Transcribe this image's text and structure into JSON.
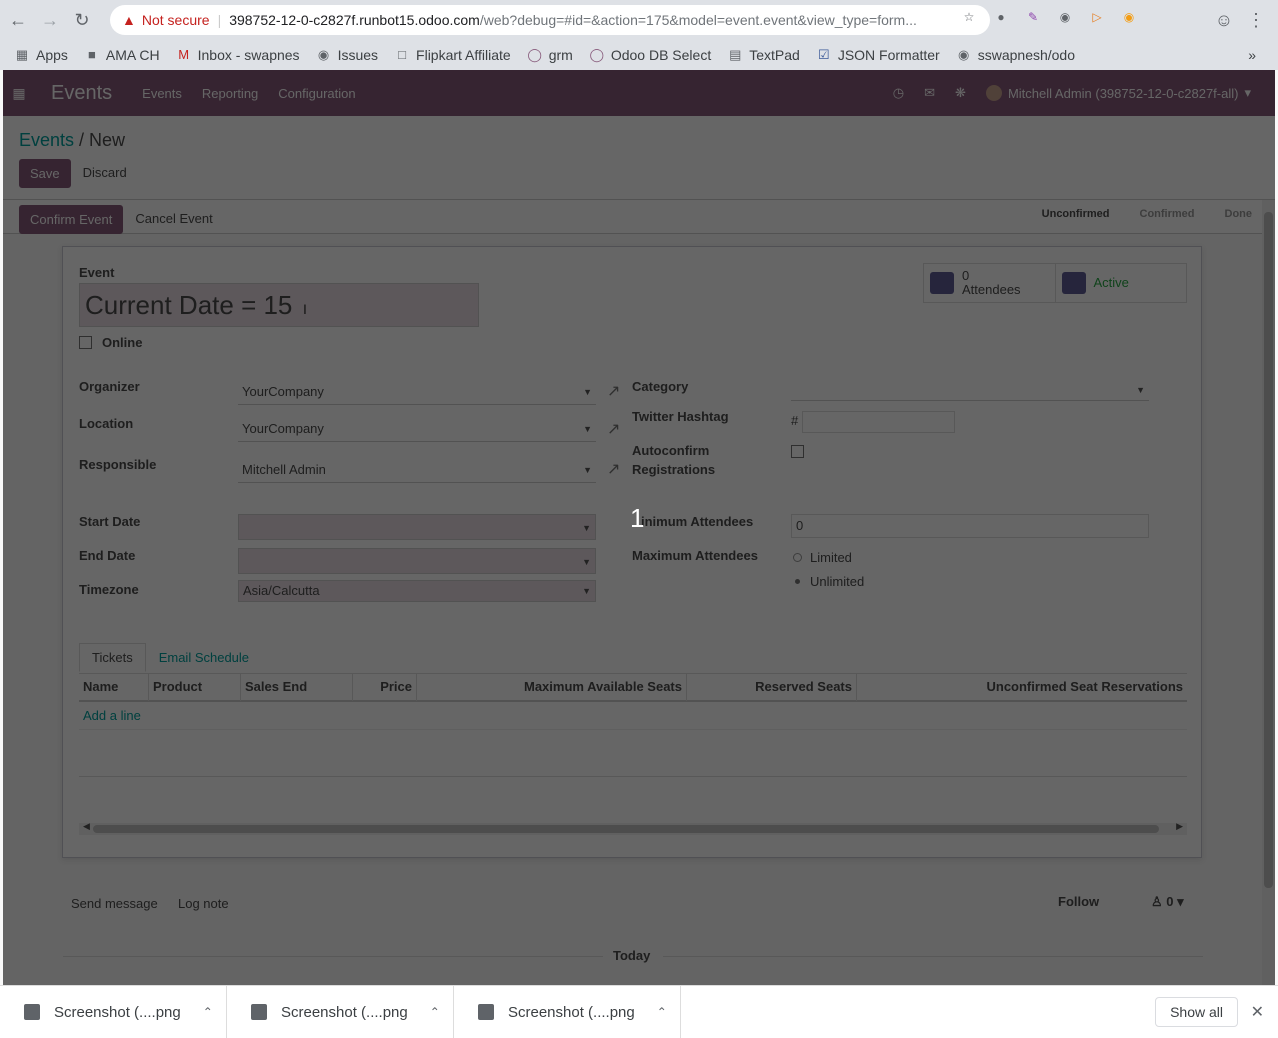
{
  "browser": {
    "security_warning": "Not secure",
    "url_host": "398752-12-0-c2827f.runbot15.odoo.com",
    "url_path": "/web?debug=#id=&action=175&model=event.event&view_type=form...",
    "bookmarks": [
      {
        "label": "Apps",
        "icon": "apps-grid-icon"
      },
      {
        "label": "AMA CH",
        "icon": "folder-icon"
      },
      {
        "label": "Inbox - swapnes",
        "icon": "gmail-icon"
      },
      {
        "label": "Issues",
        "icon": "github-icon"
      },
      {
        "label": "Flipkart Affiliate",
        "icon": "page-icon"
      },
      {
        "label": "grm",
        "icon": "circle-icon"
      },
      {
        "label": "Odoo DB Select",
        "icon": "circle-icon"
      },
      {
        "label": "TextPad",
        "icon": "notepad-icon"
      },
      {
        "label": "JSON Formatter",
        "icon": "checkbox-icon"
      },
      {
        "label": "sswapnesh/odo",
        "icon": "github-icon"
      }
    ]
  },
  "odoo_nav": {
    "app_title": "Events",
    "menus": [
      "Events",
      "Reporting",
      "Configuration"
    ],
    "user": "Mitchell Admin (398752-12-0-c2827f-all)"
  },
  "control": {
    "breadcrumb_parent": "Events",
    "breadcrumb_sep": " / ",
    "breadcrumb_current": "New",
    "save": "Save",
    "discard": "Discard"
  },
  "statusbar": {
    "confirm": "Confirm Event",
    "cancel": "Cancel Event",
    "stages": [
      "Unconfirmed",
      "Confirmed",
      "Done"
    ]
  },
  "form": {
    "event_label": "Event",
    "event_name": "Current Date = 15",
    "online_label": "Online",
    "smart_attendees_count": "0",
    "smart_attendees_label": "Attendees",
    "smart_active": "Active",
    "organizer_label": "Organizer",
    "organizer_value": "YourCompany",
    "location_label": "Location",
    "location_value": "YourCompany",
    "responsible_label": "Responsible",
    "responsible_value": "Mitchell Admin",
    "start_label": "Start Date",
    "end_label": "End Date",
    "timezone_label": "Timezone",
    "timezone_value": "Asia/Calcutta",
    "category_label": "Category",
    "twitter_label": "Twitter Hashtag",
    "twitter_prefix": "#",
    "autoconfirm_label_1": "Autoconfirm",
    "autoconfirm_label_2": "Registrations",
    "min_label": "inimum Attendees",
    "min_value": "0",
    "max_label": "Maximum Attendees",
    "limited": "Limited",
    "unlimited": "Unlimited",
    "tabs": [
      "Tickets",
      "Email Schedule"
    ],
    "columns": [
      "Name",
      "Product",
      "Sales End",
      "Price",
      "Maximum Available Seats",
      "Reserved Seats",
      "Unconfirmed Seat Reservations"
    ],
    "add_line": "Add a line"
  },
  "chatter": {
    "send_message": "Send message",
    "log_note": "Log note",
    "follow": "Follow",
    "followers": "0",
    "today": "Today"
  },
  "step_marker": "1",
  "downloads": {
    "items": [
      "Screenshot (....png",
      "Screenshot (....png",
      "Screenshot (....png"
    ],
    "show_all": "Show all"
  }
}
